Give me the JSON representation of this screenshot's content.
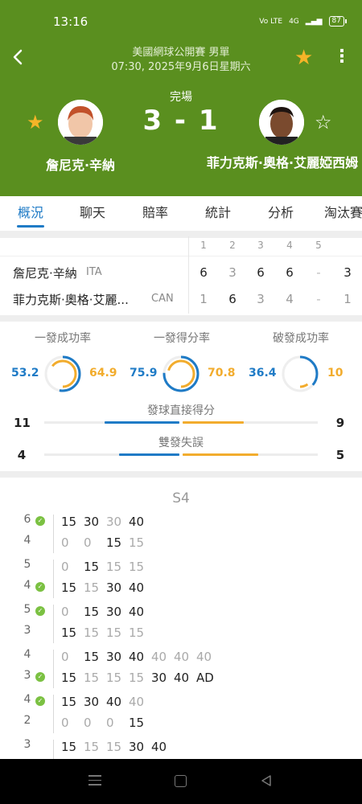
{
  "status_bar": {
    "time": "13:16",
    "network": "Vo LTE",
    "signal": "4G",
    "battery": "87"
  },
  "header": {
    "competition": "美國網球公開賽 男單",
    "datetime": "07:30, 2025年9月6日星期六",
    "status": "完場",
    "score": "3 - 1",
    "home_name": "詹尼克·辛納",
    "away_name": "菲力克斯·奧格·艾麗婭西姆",
    "icons": {
      "back": "back-chevron-icon",
      "favorite": "star-filled-icon",
      "menu": "more-vertical-icon"
    }
  },
  "tabs": [
    "概況",
    "聊天",
    "賠率",
    "統計",
    "分析",
    "淘汰賽"
  ],
  "scoreboard": {
    "set_headers": [
      "1",
      "2",
      "3",
      "4",
      "5"
    ],
    "rows": [
      {
        "name": "詹尼克·辛納",
        "country": "ITA",
        "sets": [
          "6",
          "3",
          "6",
          "6",
          "-"
        ],
        "total": "3"
      },
      {
        "name": "菲力克斯·奧格·艾麗...",
        "country": "CAN",
        "sets": [
          "1",
          "6",
          "3",
          "4",
          "-"
        ],
        "total": "1"
      }
    ]
  },
  "stats": {
    "rings": [
      {
        "title": "一發成功率",
        "home": "53.2",
        "away": "64.9"
      },
      {
        "title": "一發得分率",
        "home": "75.9",
        "away": "70.8"
      },
      {
        "title": "破發成功率",
        "home": "36.4",
        "away": "10"
      }
    ],
    "bars": [
      {
        "title": "發球直接得分",
        "home": "11",
        "away": "9"
      },
      {
        "title": "雙發失誤",
        "home": "4",
        "away": "5"
      }
    ]
  },
  "pbp": {
    "set_label": "S4",
    "games": [
      {
        "home": "6",
        "away": "4",
        "serve": "home",
        "home_pts": [
          [
            "15",
            "b"
          ],
          [
            "30",
            "b"
          ],
          [
            "30",
            "g"
          ],
          [
            "40",
            "b"
          ]
        ],
        "away_pts": [
          [
            "0",
            "g"
          ],
          [
            "0",
            "g"
          ],
          [
            "15",
            "b"
          ],
          [
            "15",
            "g"
          ]
        ]
      },
      {
        "home": "5",
        "away": "4",
        "serve": "away",
        "home_pts": [
          [
            "0",
            "g"
          ],
          [
            "15",
            "b"
          ],
          [
            "15",
            "g"
          ],
          [
            "15",
            "g"
          ]
        ],
        "away_pts": [
          [
            "15",
            "b"
          ],
          [
            "15",
            "g"
          ],
          [
            "30",
            "b"
          ],
          [
            "40",
            "b"
          ]
        ]
      },
      {
        "home": "5",
        "away": "3",
        "serve": "home",
        "home_pts": [
          [
            "0",
            "g"
          ],
          [
            "15",
            "b"
          ],
          [
            "30",
            "b"
          ],
          [
            "40",
            "b"
          ]
        ],
        "away_pts": [
          [
            "15",
            "b"
          ],
          [
            "15",
            "g"
          ],
          [
            "15",
            "g"
          ],
          [
            "15",
            "g"
          ]
        ]
      },
      {
        "home": "4",
        "away": "3",
        "serve": "away",
        "home_pts": [
          [
            "0",
            "g"
          ],
          [
            "15",
            "b"
          ],
          [
            "30",
            "b"
          ],
          [
            "40",
            "b"
          ],
          [
            "40",
            "g"
          ],
          [
            "40",
            "g"
          ],
          [
            "40",
            "g"
          ]
        ],
        "away_pts": [
          [
            "15",
            "b"
          ],
          [
            "15",
            "g"
          ],
          [
            "15",
            "g"
          ],
          [
            "15",
            "g"
          ],
          [
            "30",
            "b"
          ],
          [
            "40",
            "b"
          ],
          [
            "AD",
            "b"
          ]
        ]
      },
      {
        "home": "4",
        "away": "2",
        "serve": "home",
        "home_pts": [
          [
            "15",
            "b"
          ],
          [
            "30",
            "b"
          ],
          [
            "40",
            "b"
          ],
          [
            "40",
            "g"
          ]
        ],
        "away_pts": [
          [
            "0",
            "g"
          ],
          [
            "0",
            "g"
          ],
          [
            "0",
            "g"
          ],
          [
            "15",
            "b"
          ]
        ]
      },
      {
        "home": "3",
        "away": "",
        "serve": "",
        "home_pts": [
          [
            "15",
            "b"
          ],
          [
            "15",
            "g"
          ],
          [
            "15",
            "g"
          ],
          [
            "30",
            "b"
          ],
          [
            "40",
            "b"
          ]
        ],
        "away_pts": []
      }
    ]
  },
  "nav": {
    "menu": "menu-icon",
    "home": "home-icon",
    "back": "back-triangle-icon"
  }
}
